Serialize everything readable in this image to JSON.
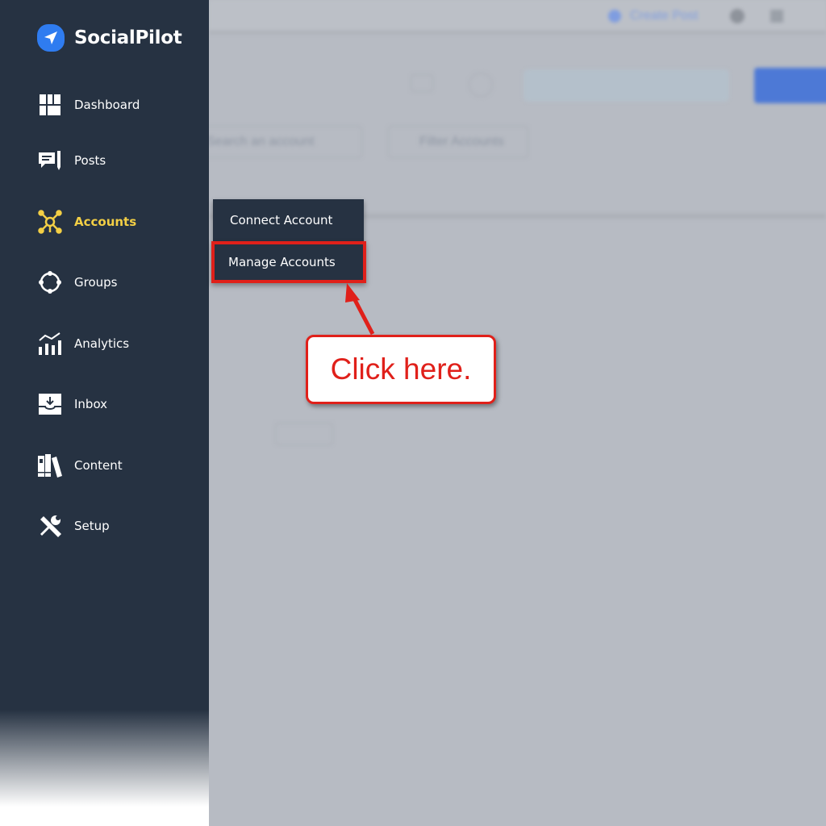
{
  "app": {
    "name": "SocialPilot",
    "logo_icon": "paper-plane-icon",
    "brand_color": "#2f7cf0"
  },
  "sidebar": {
    "background": "#263242",
    "active_color": "#f3cf45",
    "items": [
      {
        "label": "Dashboard",
        "icon": "dashboard-icon"
      },
      {
        "label": "Posts",
        "icon": "posts-icon"
      },
      {
        "label": "Accounts",
        "icon": "accounts-icon",
        "active": true
      },
      {
        "label": "Groups",
        "icon": "groups-icon"
      },
      {
        "label": "Analytics",
        "icon": "analytics-icon"
      },
      {
        "label": "Inbox",
        "icon": "inbox-icon"
      },
      {
        "label": "Content",
        "icon": "content-icon"
      },
      {
        "label": "Setup",
        "icon": "setup-icon"
      }
    ]
  },
  "submenu": {
    "items": [
      {
        "label": "Connect Account"
      },
      {
        "label": "Manage Accounts",
        "highlighted": true
      }
    ]
  },
  "background": {
    "create_post": "Create Post",
    "search_placeholder": "Search an account",
    "filter": "Filter Accounts"
  },
  "annotation": {
    "text": "Click here.",
    "color": "#e0201a"
  }
}
